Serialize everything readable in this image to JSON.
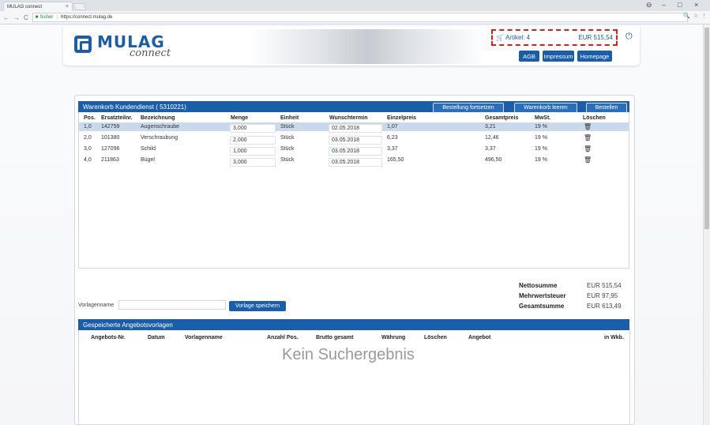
{
  "browser": {
    "tab_title": "MULAG connect",
    "tab_close": "×",
    "url_secure": "Sicher",
    "url": "https://connect.mulag.de",
    "win_min": "–",
    "win_max": "□",
    "win_close": "×",
    "profile": "⊖",
    "nav_back": "←",
    "nav_fwd": "→",
    "nav_reload": "C",
    "zoom_icon": "🔍",
    "star_icon": "☆",
    "menu_icon": "⋮"
  },
  "header": {
    "logo_text": "MULAG",
    "logo_sub": "connect",
    "cart_label": "Artikel: 4",
    "cart_amount": "EUR 515,54",
    "nav": [
      "AGB",
      "Impressum",
      "Homepage"
    ]
  },
  "cart": {
    "title": "Warenkorb Kundendienst ( 5310221)",
    "buttons": [
      "Bestellung fortsetzen",
      "Warenkorb leeren",
      "Bestellen"
    ],
    "columns": [
      "Pos.",
      "Ersatzteilnr.",
      "Bezeichnung",
      "Menge",
      "Einheit",
      "Wunschtermin",
      "Einzelpreis",
      "Gesamtpreis",
      "MwSt.",
      "Löschen"
    ],
    "rows": [
      {
        "pos": "1,0",
        "nr": "142759",
        "bez": "Augenschraube",
        "menge": "3,000",
        "einheit": "Stück",
        "termin": "02.05.2018",
        "einzel": "1,07",
        "gesamt": "3,21",
        "mwst": "19 %"
      },
      {
        "pos": "2,0",
        "nr": "101380",
        "bez": "Verschraubung",
        "menge": "2,000",
        "einheit": "Stück",
        "termin": "03.05.2018",
        "einzel": "6,23",
        "gesamt": "12,46",
        "mwst": "19 %"
      },
      {
        "pos": "3,0",
        "nr": "127096",
        "bez": "Schild",
        "menge": "1,000",
        "einheit": "Stück",
        "termin": "03.05.2018",
        "einzel": "3,37",
        "gesamt": "3,37",
        "mwst": "19 %"
      },
      {
        "pos": "4,0",
        "nr": "211863",
        "bez": "Bügel",
        "menge": "3,000",
        "einheit": "Stück",
        "termin": "03.05.2018",
        "einzel": "165,50",
        "gesamt": "496,50",
        "mwst": "19 %"
      }
    ],
    "trash_icon": "🗑"
  },
  "totals": {
    "labels": [
      "Nettosumme",
      "Mehrwertsteuer",
      "Gesamtsumme"
    ],
    "values": [
      "EUR 515,54",
      "EUR 97,95",
      "EUR 613,49"
    ]
  },
  "vorlage": {
    "label": "Vorlagenname",
    "value": "",
    "button": "Vorlage speichern"
  },
  "saved": {
    "title": "Gespeicherte Angebotsvorlagen",
    "columns": [
      "Angebots-Nr.",
      "Datum",
      "Vorlagenname",
      "Anzahl Pos.",
      "Brutto gesamt",
      "Währung",
      "Löschen",
      "Angebot",
      "in Wkb."
    ],
    "empty": "Kein Suchergebnis"
  }
}
